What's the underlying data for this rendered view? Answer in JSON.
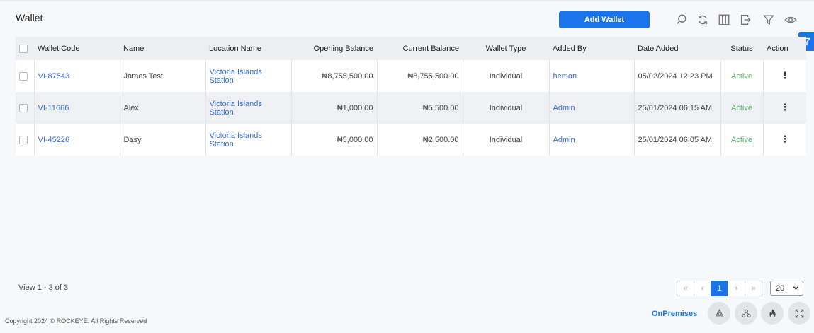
{
  "page": {
    "title": "Wallet"
  },
  "toolbar": {
    "add_label": "Add Wallet",
    "icons": [
      "search-icon",
      "refresh-icon",
      "columns-icon",
      "export-icon",
      "filter-icon",
      "eye-icon"
    ],
    "accent": "#1a73e8"
  },
  "table": {
    "headers": [
      "Wallet Code",
      "Name",
      "Location Name",
      "Opening Balance",
      "Current Balance",
      "Wallet Type",
      "Added By",
      "Date Added",
      "Status",
      "Action"
    ],
    "rows": [
      {
        "code": "VI-87543",
        "name": "James Test",
        "location": "Victoria Islands Station",
        "opening": "₦8,755,500.00",
        "current": "₦8,755,500.00",
        "type": "Individual",
        "added_by": "heman",
        "date": "05/02/2024 12:23 PM",
        "status": "Active"
      },
      {
        "code": "VI-11666",
        "name": "Alex",
        "location": "Victoria Islands Station",
        "opening": "₦1,000.00",
        "current": "₦5,500.00",
        "type": "Individual",
        "added_by": "Admin",
        "date": "25/01/2024 06:15 AM",
        "status": "Active"
      },
      {
        "code": "VI-45226",
        "name": "Dasy",
        "location": "Victoria Islands Station",
        "opening": "₦5,000.00",
        "current": "₦2,500.00",
        "type": "Individual",
        "added_by": "Admin",
        "date": "25/01/2024 06:05 AM",
        "status": "Active"
      }
    ],
    "status_color": "#56b36b",
    "link_color": "#3b6fd8"
  },
  "footer": {
    "view_count": "View 1 - 3 of 3",
    "pager": {
      "first": "«",
      "prev": "‹",
      "current": "1",
      "next": "›",
      "last": "»"
    },
    "page_size": "20",
    "copyright": "Copyright 2024 © ROCKEYE. All Rights Reserved",
    "onprem": "OnPremises"
  }
}
